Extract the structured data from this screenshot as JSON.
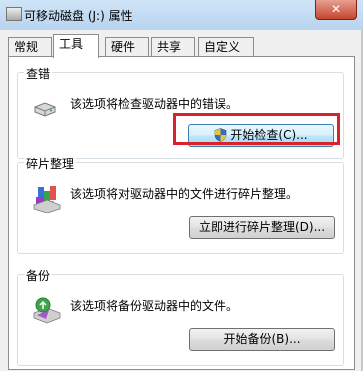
{
  "window": {
    "title": "可移动磁盘 (J:) 属性",
    "close_label": "✕"
  },
  "tabs": [
    {
      "label": "常规"
    },
    {
      "label": "工具",
      "active": true
    },
    {
      "label": "硬件"
    },
    {
      "label": "共享"
    },
    {
      "label": "自定义"
    }
  ],
  "groups": {
    "error_check": {
      "title": "查错",
      "description": "该选项将检查驱动器中的错误。",
      "button": "开始检查(C)..."
    },
    "defrag": {
      "title": "碎片整理",
      "description": "该选项将对驱动器中的文件进行碎片整理。",
      "button": "立即进行碎片整理(D)..."
    },
    "backup": {
      "title": "备份",
      "description": "该选项将备份驱动器中的文件。",
      "button": "开始备份(B)..."
    }
  },
  "colors": {
    "highlight": "#d8232a",
    "tab_border": "#8d8d8d"
  },
  "icons": [
    "drive-icon",
    "defrag-icon",
    "backup-icon",
    "shield-icon"
  ]
}
